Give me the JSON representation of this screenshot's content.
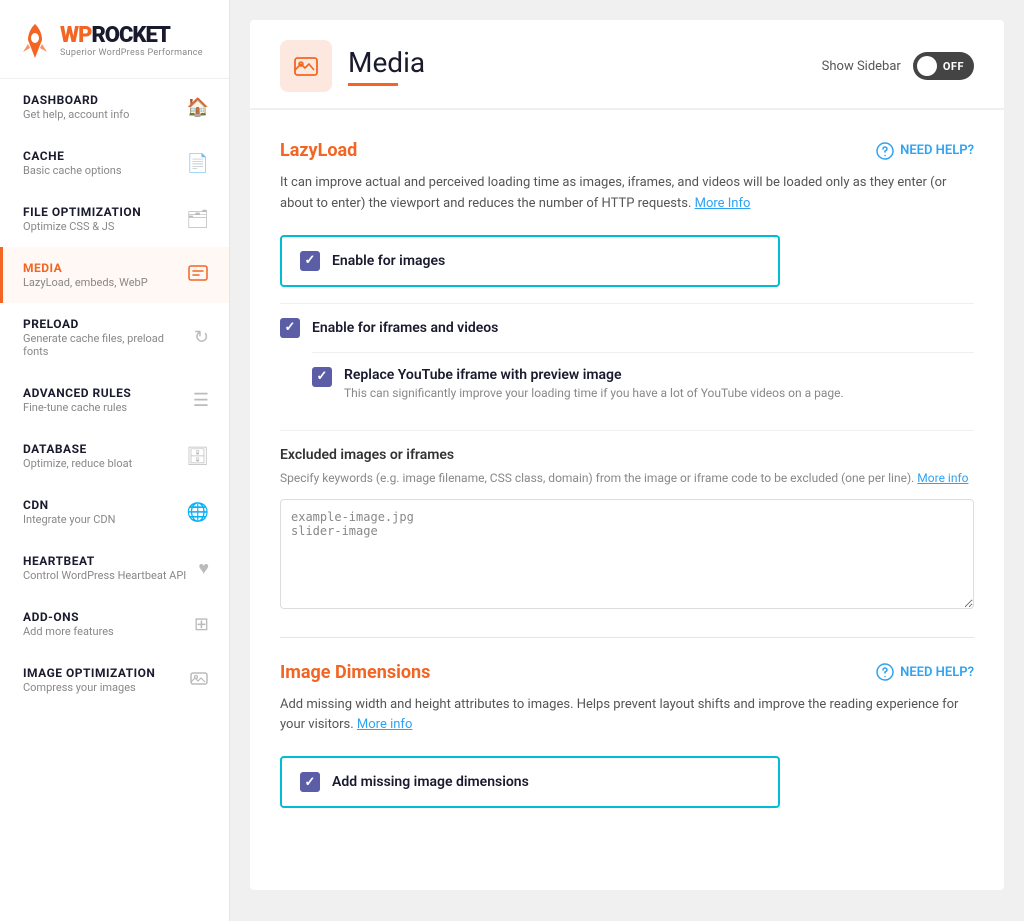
{
  "brand": {
    "wp": "WP",
    "rocket": "ROCKET",
    "tagline": "Superior WordPress Performance"
  },
  "sidebar": {
    "items": [
      {
        "id": "dashboard",
        "title": "DASHBOARD",
        "desc": "Get help, account info",
        "icon": "🏠",
        "active": false
      },
      {
        "id": "cache",
        "title": "CACHE",
        "desc": "Basic cache options",
        "icon": "📄",
        "active": false
      },
      {
        "id": "file-optimization",
        "title": "FILE OPTIMIZATION",
        "desc": "Optimize CSS & JS",
        "icon": "🗂",
        "active": false
      },
      {
        "id": "media",
        "title": "MEDIA",
        "desc": "LazyLoad, embeds, WebP",
        "icon": "🖼",
        "active": true
      },
      {
        "id": "preload",
        "title": "PRELOAD",
        "desc": "Generate cache files, preload fonts",
        "icon": "↻",
        "active": false
      },
      {
        "id": "advanced-rules",
        "title": "ADVANCED RULES",
        "desc": "Fine-tune cache rules",
        "icon": "☰",
        "active": false
      },
      {
        "id": "database",
        "title": "DATABASE",
        "desc": "Optimize, reduce bloat",
        "icon": "🗄",
        "active": false
      },
      {
        "id": "cdn",
        "title": "CDN",
        "desc": "Integrate your CDN",
        "icon": "🌐",
        "active": false
      },
      {
        "id": "heartbeat",
        "title": "HEARTBEAT",
        "desc": "Control WordPress Heartbeat API",
        "icon": "♥",
        "active": false
      },
      {
        "id": "add-ons",
        "title": "ADD-ONS",
        "desc": "Add more features",
        "icon": "⊞",
        "active": false
      },
      {
        "id": "image-optimization",
        "title": "IMAGE OPTIMIZATION",
        "desc": "Compress your images",
        "icon": "🖼",
        "active": false
      }
    ]
  },
  "page": {
    "title": "Media",
    "icon": "🖼",
    "show_sidebar_label": "Show Sidebar",
    "toggle_state": "OFF"
  },
  "sections": {
    "lazyload": {
      "title": "LazyLoad",
      "need_help": "NEED HELP?",
      "description": "It can improve actual and perceived loading time as images, iframes, and videos will be loaded only as they enter (or about to enter) the viewport and reduces the number of HTTP requests.",
      "more_info_link": "More Info",
      "enable_images_label": "Enable for images",
      "enable_images_checked": true,
      "enable_iframes_label": "Enable for iframes and videos",
      "enable_iframes_checked": true,
      "replace_youtube_label": "Replace YouTube iframe with preview image",
      "replace_youtube_checked": true,
      "replace_youtube_desc": "This can significantly improve your loading time if you have a lot of YouTube videos on a page.",
      "excluded_title": "Excluded images or iframes",
      "excluded_desc": "Specify keywords (e.g. image filename, CSS class, domain) from the image or iframe code to be excluded (one per line).",
      "excluded_more_info": "More info",
      "excluded_placeholder": "example-image.jpg\nslider-image"
    },
    "image_dimensions": {
      "title": "Image Dimensions",
      "need_help": "NEED HELP?",
      "description": "Add missing width and height attributes to images. Helps prevent layout shifts and improve the reading experience for your visitors.",
      "more_info_link": "More info",
      "add_missing_label": "Add missing image dimensions",
      "add_missing_checked": true
    }
  }
}
